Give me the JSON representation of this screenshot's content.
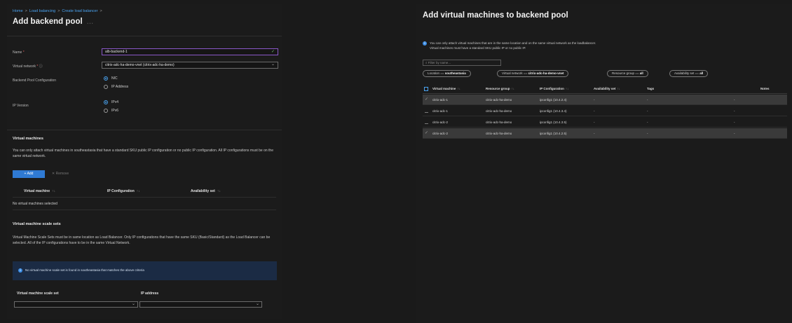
{
  "left": {
    "breadcrumb": [
      "Home",
      "Load balancing",
      "Create load balancer"
    ],
    "title": "Add backend pool",
    "title_extra": "...",
    "name": {
      "label": "Name",
      "value": "alb-backend-1"
    },
    "vnet": {
      "label": "Virtual network",
      "value": "citrix-adc-ha-demo-vnet (citrix-adc-ha-demo)"
    },
    "pool_config": {
      "label": "Backend Pool Configuration",
      "options": [
        "NIC",
        "IP Address"
      ],
      "selected": "NIC"
    },
    "ip_version": {
      "label": "IP Version",
      "options": [
        "IPv4",
        "IPv6"
      ],
      "selected": "IPv4"
    },
    "vm_section": {
      "title": "Virtual machines",
      "desc": "You can only attach virtual machines in southeastasia that have a standard SKU public IP configuration or no public IP configuration. All IP configurations must be on the same virtual network.",
      "add_label": "+ Add",
      "remove_label": "✕ Remove",
      "columns": [
        "Virtual machine",
        "IP Configuration",
        "Availability set"
      ],
      "empty": "No virtual machines selected"
    },
    "vmss_section": {
      "title": "Virtual machine scale sets",
      "desc": "Virtual Machine Scale Sets must be in same location as Load Balancer. Only IP configurations that have the same SKU (Basic/Standard) as the Load Balancer can be selected. All of the IP configurations have to be in the same Virtual Network.",
      "info": "No virtual machine scale set is found in southeastasia that matches the above criteria",
      "columns": [
        "Virtual machine scale set",
        "IP address"
      ]
    }
  },
  "right": {
    "title": "Add virtual machines to backend pool",
    "info_line1": "You can only attach virtual machines that are in the same location and on the same virtual network as the loadbalancer.",
    "info_line2": "Virtual machines must have a standard SKU public IP or no public IP.",
    "filter_placeholder": "Filter by name...",
    "pills": [
      {
        "text": "Location == ",
        "bold": "southeastasia"
      },
      {
        "text": "Virtual network == ",
        "bold": "citrix-adc-ha-demo-vnet"
      },
      {
        "text": "Resource group == ",
        "bold": "all"
      },
      {
        "text": "Availability set == ",
        "bold": "all"
      }
    ],
    "columns": [
      "Virtual machine",
      "Resource group",
      "IP Configuration",
      "Availability set",
      "Tags",
      "Notes"
    ],
    "rows": [
      {
        "vm": "citrix-adc-1",
        "rg": "citrix-adc-ha-demo",
        "ip": "ipconfig1 (10.4.2.4)",
        "as": "-",
        "tags": "-",
        "notes": "-",
        "selected": true
      },
      {
        "vm": "citrix-adc-1",
        "rg": "citrix-adc-ha-demo",
        "ip": "ipconfig1 (10.4.3.4)",
        "as": "-",
        "tags": "-",
        "notes": "-",
        "selected": false
      },
      {
        "vm": "citrix-adc-2",
        "rg": "citrix-adc-ha-demo",
        "ip": "ipconfig1 (10.4.3.5)",
        "as": "-",
        "tags": "-",
        "notes": "-",
        "selected": false
      },
      {
        "vm": "citrix-adc-2",
        "rg": "citrix-adc-ha-demo",
        "ip": "ipconfig1 (10.4.2.5)",
        "as": "-",
        "tags": "-",
        "notes": "-",
        "selected": true
      }
    ]
  }
}
